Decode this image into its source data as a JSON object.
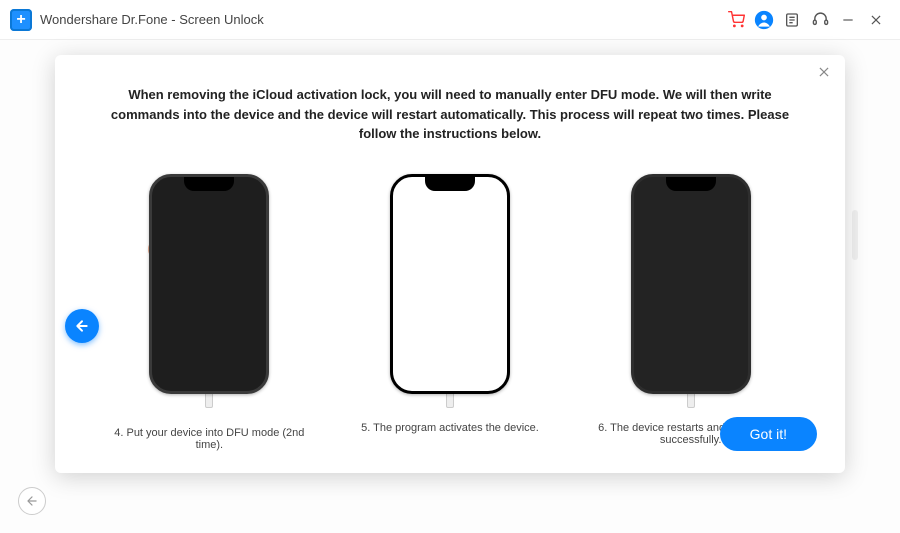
{
  "titlebar": {
    "title": "Wondershare Dr.Fone - Screen Unlock"
  },
  "modal": {
    "instructions": "When removing the iCloud activation lock, you will need to manually enter DFU mode. We will then write commands into the device and the device will restart automatically. This process will repeat two times. Please follow the instructions below.",
    "steps": [
      {
        "caption": "4. Put your device into DFU mode (2nd time)."
      },
      {
        "caption": "5. The program activates the device."
      },
      {
        "caption": "6. The device restarts and is unlocked successfully."
      }
    ],
    "got_it": "Got it!"
  }
}
